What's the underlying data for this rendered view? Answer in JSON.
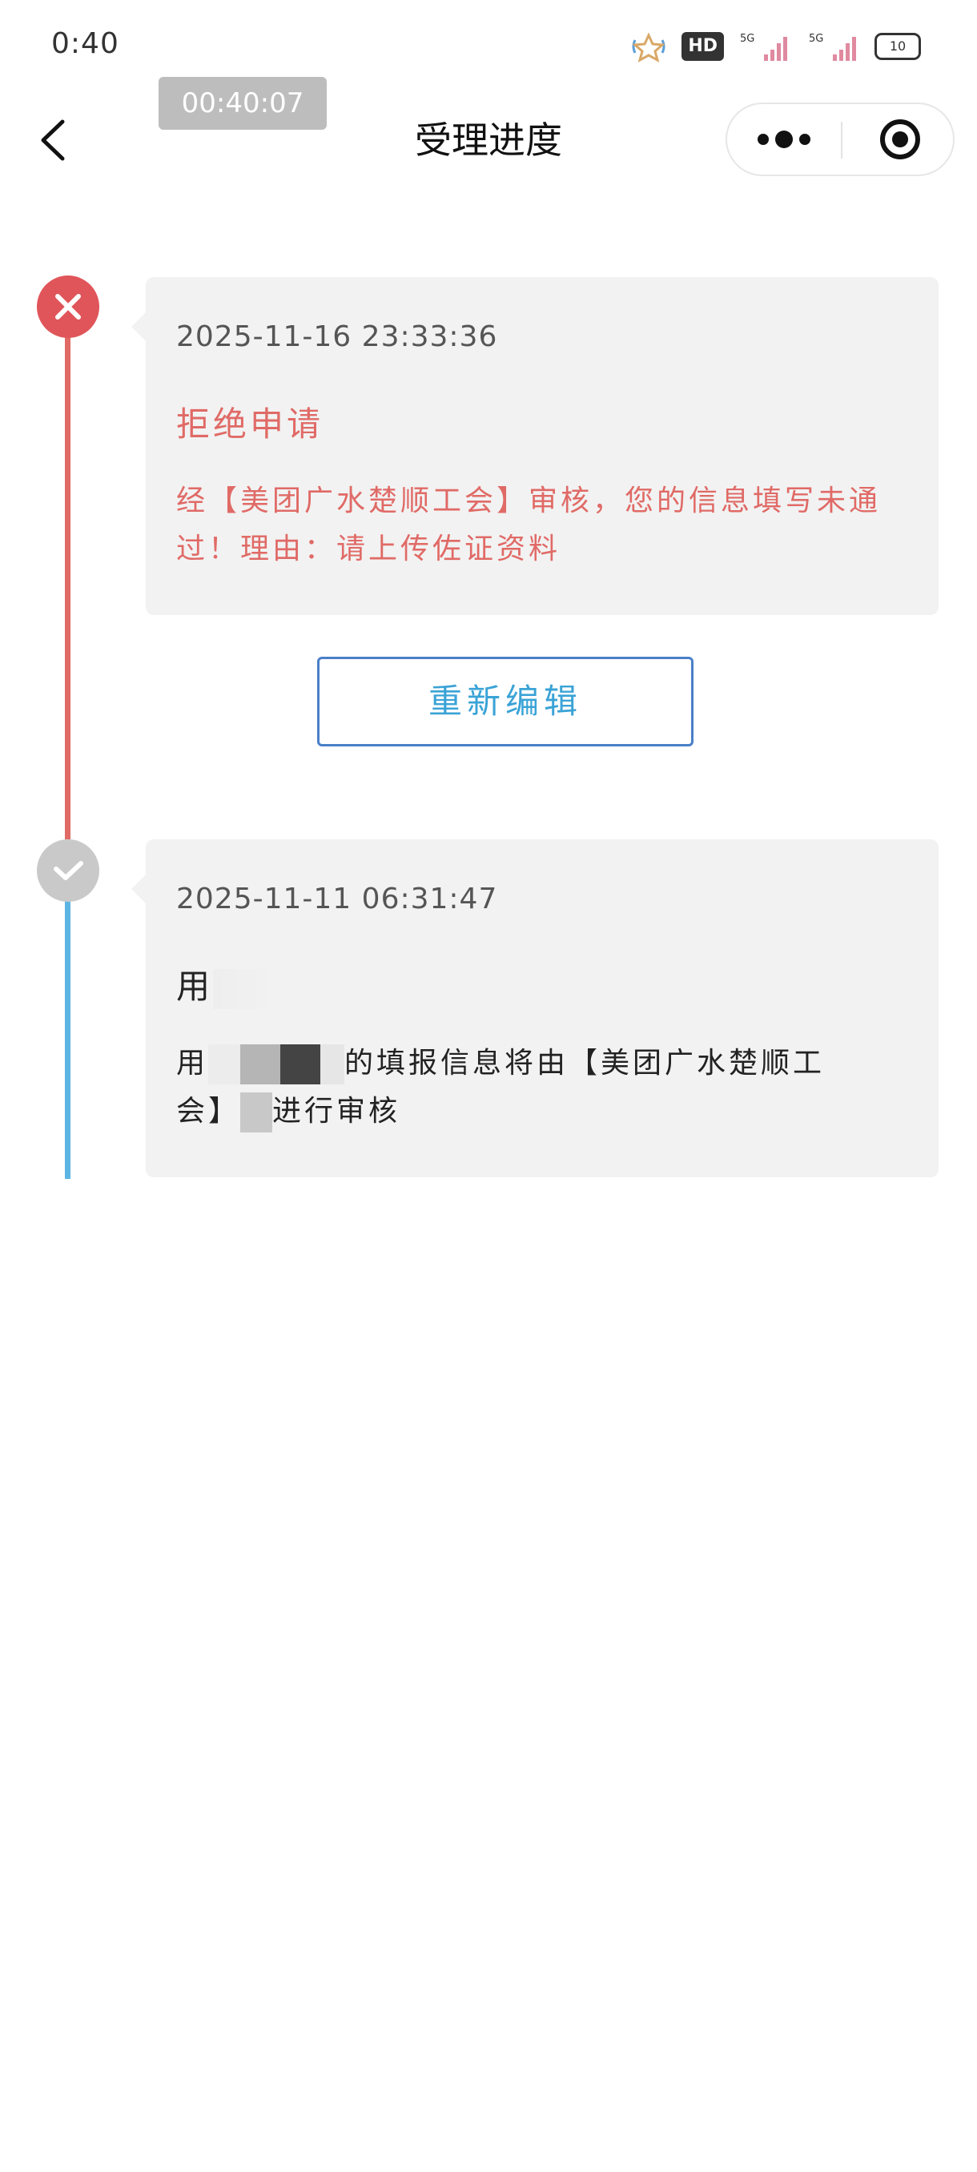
{
  "status_bar": {
    "time": "0:40",
    "hd_label": "HD",
    "battery": "10"
  },
  "recording_timer": "00:40:07",
  "nav": {
    "title": "受理进度"
  },
  "timeline": [
    {
      "status": "rejected",
      "time": "2025-11-16  23:33:36",
      "title": "拒绝申请",
      "description": "经【美团广水楚顺工会】审核，您的信息填写未通过！理由：请上传佐证资料"
    },
    {
      "status": "submitted",
      "time": "2025-11-11  06:31:47",
      "title": "用",
      "desc_prefix": "用",
      "desc_middle": "的填报信息将由【美团广水楚顺工",
      "desc_line2_prefix": "会】",
      "desc_line2_suffix": "进行审核"
    }
  ],
  "actions": {
    "reedit_label": "重新编辑"
  },
  "colors": {
    "rejected": "#e0555a",
    "submitted_line": "#5db5e3",
    "button_border": "#4a7fc8",
    "button_text": "#3aa3d6"
  },
  "icons": {
    "back": "chevron-left-icon",
    "more": "more-dots-icon",
    "close": "target-close-icon",
    "rejected": "x-circle-icon",
    "submitted": "check-circle-icon"
  }
}
